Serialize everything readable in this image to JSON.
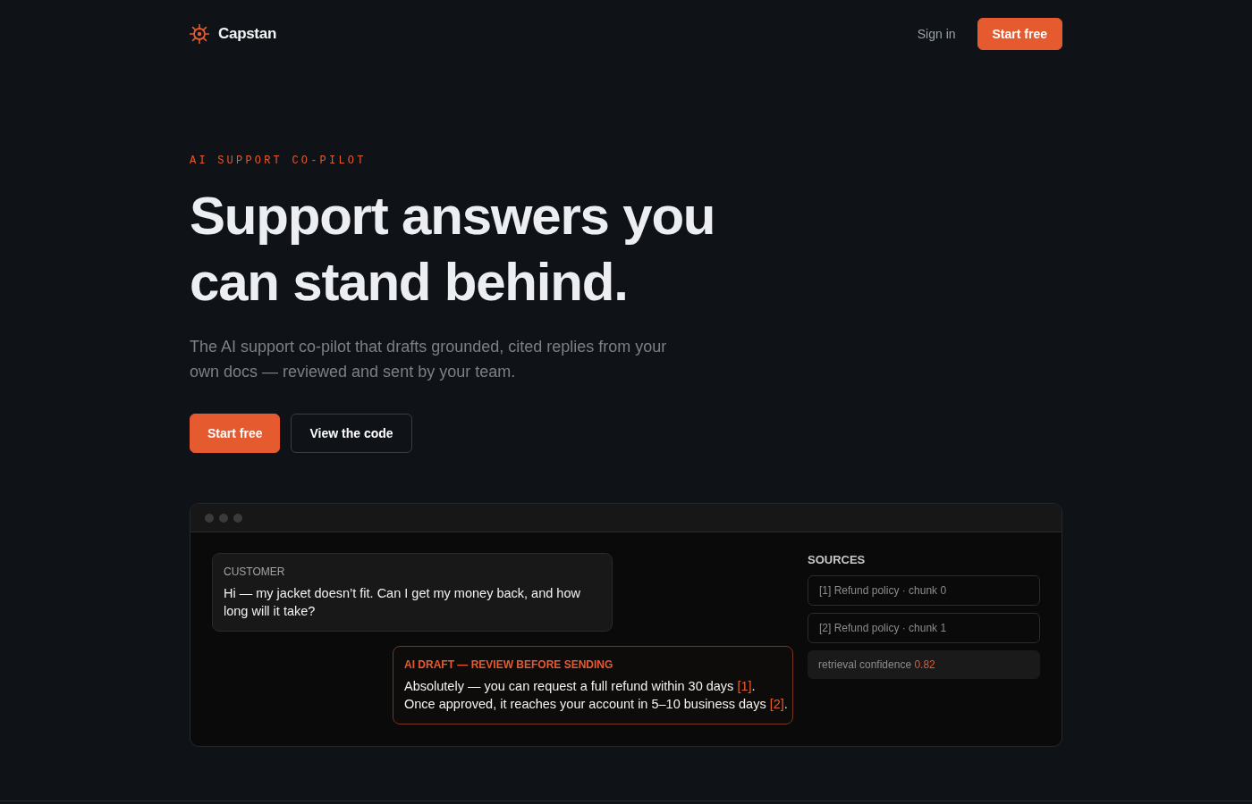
{
  "nav": {
    "brand": "Capstan",
    "links": [
      {
        "label": "Sign in",
        "kind": "link"
      },
      {
        "label": "Start free",
        "kind": "primary"
      }
    ]
  },
  "hero": {
    "eyebrow": "AI SUPPORT CO-PILOT",
    "headline": "Support answers you can stand behind.",
    "subtitle": "The AI support co-pilot that drafts grounded, cited replies from your own docs — reviewed and sent by your team.",
    "buttons": [
      {
        "label": "Start free",
        "kind": "primary"
      },
      {
        "label": "View the code",
        "kind": "outline"
      }
    ]
  },
  "demo": {
    "messages": [
      {
        "kind": "customer",
        "label": "CUSTOMER",
        "text": [
          {
            "kind": "plain",
            "text": "Hi — my jacket doesn’t fit. Can I get my money back, and how long will it take?"
          }
        ]
      },
      {
        "kind": "draft",
        "label": "AI DRAFT — REVIEW BEFORE SENDING",
        "text": [
          {
            "kind": "plain",
            "text": "Absolutely — you can request a full refund within 30 days "
          },
          {
            "kind": "citation",
            "text": "[1]"
          },
          {
            "kind": "plain",
            "text": ". Once approved, it reaches your account in 5–10 business days "
          },
          {
            "kind": "citation",
            "text": "[2]"
          },
          {
            "kind": "plain",
            "text": "."
          }
        ]
      }
    ],
    "sources": {
      "title": "SOURCES",
      "items": [
        "[1] Refund policy · chunk 0",
        "[2] Refund policy · chunk 1"
      ],
      "confidence": {
        "label": "retrieval confidence",
        "value": "0.82"
      }
    }
  }
}
